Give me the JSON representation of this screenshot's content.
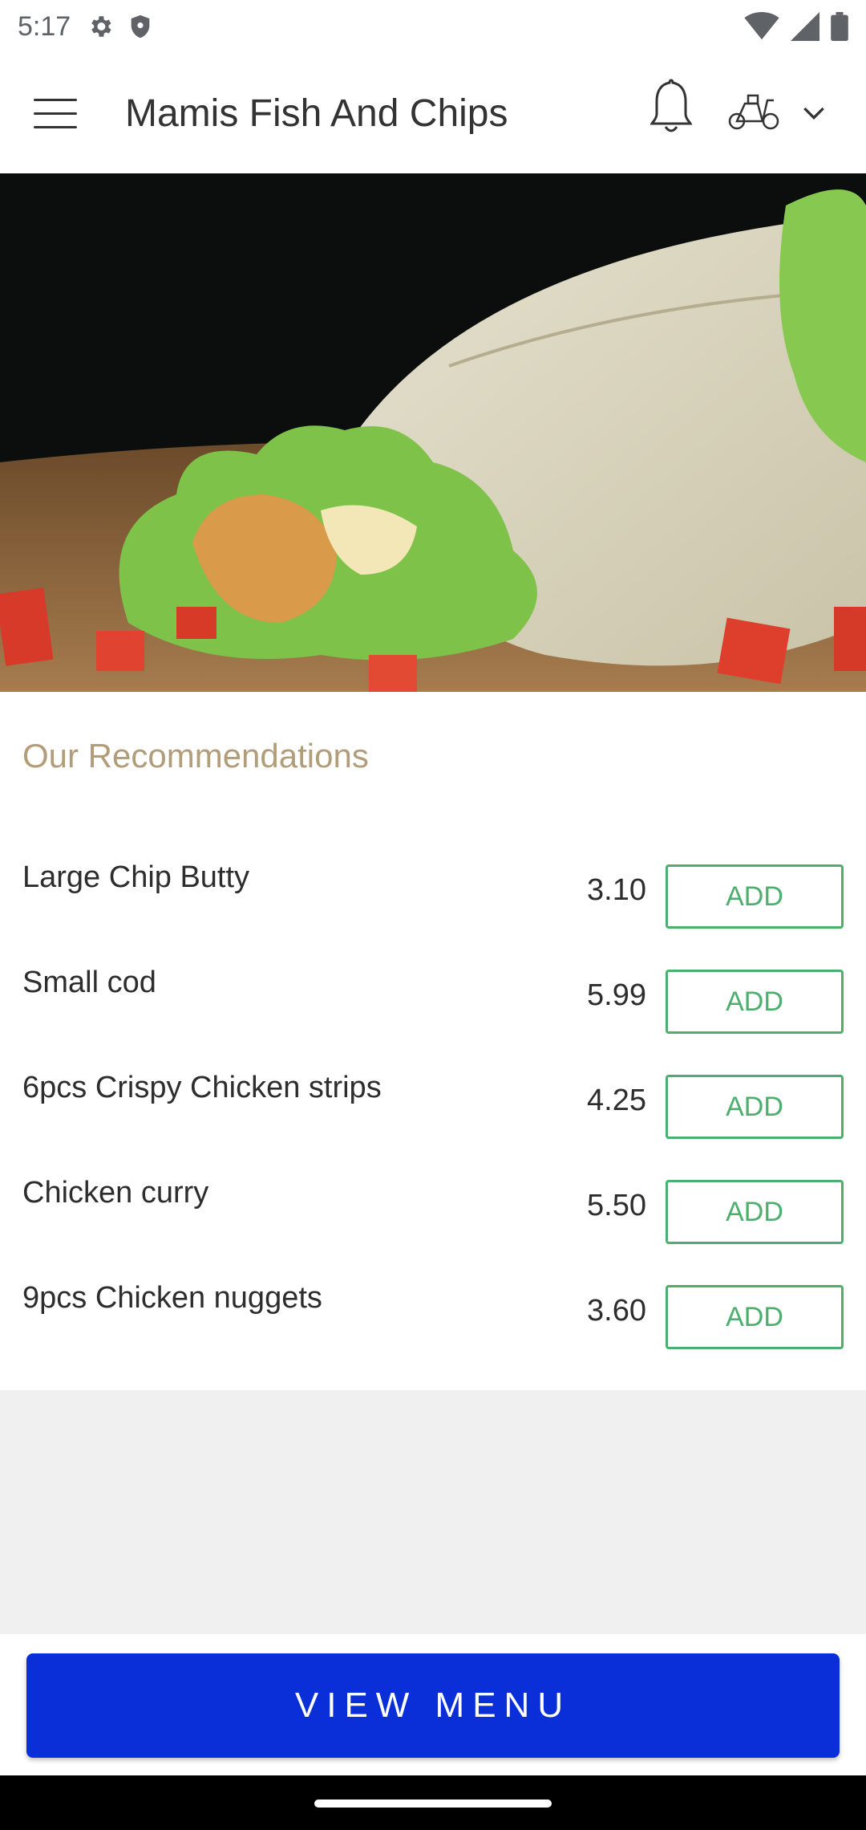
{
  "status_bar": {
    "time": "5:17",
    "icons": [
      "settings-icon",
      "shield-icon",
      "wifi-icon",
      "signal-icon",
      "battery-icon"
    ]
  },
  "app_bar": {
    "title": "Mamis Fish And Chips",
    "icons": [
      "hamburger-menu-icon",
      "bell-icon",
      "scooter-icon",
      "chevron-down-icon"
    ]
  },
  "hero": {
    "image": "chicken-wrap-photo"
  },
  "recommendations": {
    "title": "Our Recommendations",
    "items": [
      {
        "name": "Large Chip Butty",
        "price": "3.10",
        "button": "ADD"
      },
      {
        "name": "Small cod",
        "price": "5.99",
        "button": "ADD"
      },
      {
        "name": "6pcs Crispy Chicken strips",
        "price": "4.25",
        "button": "ADD"
      },
      {
        "name": "Chicken curry",
        "price": "5.50",
        "button": "ADD"
      },
      {
        "name": "9pcs Chicken nuggets",
        "price": "3.60",
        "button": "ADD"
      }
    ]
  },
  "footer": {
    "view_menu_label": "VIEW MENU"
  },
  "colors": {
    "accent_green": "#4caf6e",
    "heading_tan": "#b29d7a",
    "primary_blue": "#0a2fd9"
  }
}
